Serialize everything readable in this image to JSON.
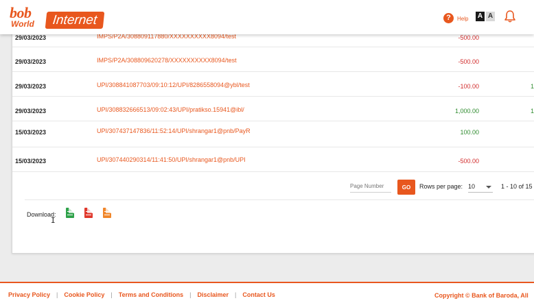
{
  "header": {
    "logo_bob": "bob",
    "logo_world": "World",
    "logo_internet": "Internet",
    "help_label": "Help",
    "font_large": "A",
    "font_small": "A"
  },
  "transactions": [
    {
      "date": "29/03/2023",
      "desc": "IMPS/P2A/308809117880/XXXXXXXXXX8094/test",
      "amount": "-500.00",
      "type": "neg",
      "balance": ""
    },
    {
      "date": "29/03/2023",
      "desc": "IMPS/P2A/308809620278/XXXXXXXXXX8094/test",
      "amount": "-500.00",
      "type": "neg",
      "balance": ""
    },
    {
      "date": "29/03/2023",
      "desc": "UPI/308841087703/09:10:12/UPI/8286558094@ybl/test",
      "amount": "-100.00",
      "type": "neg",
      "balance": "1"
    },
    {
      "date": "29/03/2023",
      "desc": "UPI/308832666513/09:02:43/UPI/pratikso.15941@ibl/",
      "amount": "1,000.00",
      "type": "pos",
      "balance": "1"
    },
    {
      "date": "15/03/2023",
      "desc": "UPI/307437147836/11:52:14/UPI/shrangar1@pnb/PayR",
      "amount": "100.00",
      "type": "pos",
      "balance": ""
    },
    {
      "date": "15/03/2023",
      "desc": "UPI/307440290314/11:41:50/UPI/shrangar1@pnb/UPI",
      "amount": "-500.00",
      "type": "neg",
      "balance": ""
    }
  ],
  "pager": {
    "page_number_placeholder": "Page Number",
    "go_label": "GO",
    "rows_label": "Rows per page:",
    "rows_value": "10",
    "range": "1 - 10 of 15",
    "prev": "‹"
  },
  "download": {
    "label": "Download:"
  },
  "footer": {
    "links": [
      "Privacy Policy",
      "Cookie Policy",
      "Terms and Conditions",
      "Disclaimer",
      "Contact Us"
    ],
    "separator": "|",
    "copyright": "Copyright © Bank of Baroda, All"
  },
  "colors": {
    "brand": "#e8571e",
    "negative": "#d12b2b",
    "positive": "#2e8b2e"
  }
}
